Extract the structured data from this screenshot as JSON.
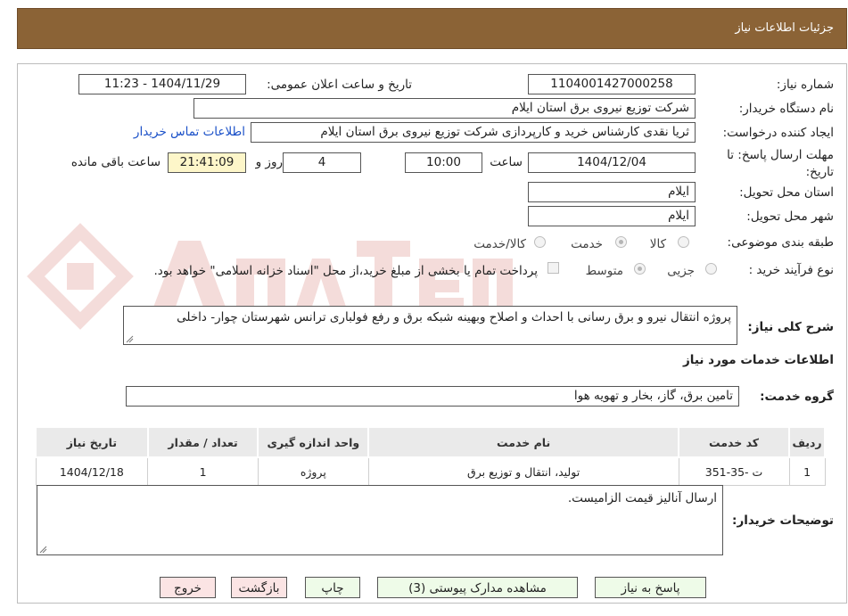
{
  "header": {
    "title": "جزئیات اطلاعات نیاز"
  },
  "form": {
    "need_number_label": "شماره نیاز:",
    "need_number": "1104001427000258",
    "announce_label": "تاریخ و ساعت اعلان عمومی:",
    "announce_value": "1404/11/29 - 11:23",
    "buyer_org_label": "نام دستگاه خریدار:",
    "buyer_org": "شرکت توزیع نیروی برق استان ایلام",
    "creator_label": "ایجاد کننده درخواست:",
    "creator": "ثریا نقدی کارشناس خرید و کارپردازی شرکت توزیع نیروی برق استان ایلام",
    "contact_link": "اطلاعات تماس خریدار",
    "deadline_label": "مهلت ارسال پاسخ: تا تاریخ:",
    "deadline_date": "1404/12/04",
    "time_label": "ساعت",
    "deadline_time": "10:00",
    "days_value": "4",
    "days_label": "روز و",
    "remaining_time": "21:41:09",
    "remaining_label": "ساعت باقی مانده",
    "province_label": "استان محل تحویل:",
    "province": "ایلام",
    "city_label": "شهر محل تحویل:",
    "city": "ایلام",
    "category_label": "طبقه بندی موضوعی:",
    "category_options": [
      "کالا",
      "خدمت",
      "کالا/خدمت"
    ],
    "category_selected": "خدمت",
    "process_label": "نوع فرآیند خرید :",
    "process_options": [
      "جزیی",
      "متوسط"
    ],
    "process_selected": "متوسط",
    "payment_note": "پرداخت تمام یا بخشی از مبلغ خرید،از محل \"اسناد خزانه اسلامی\" خواهد بود.",
    "description_label": "شرح کلی نیاز:",
    "description": "پروژه انتقال نیرو و برق رسانی با احداث و اصلاح وبهینه شبکه برق و رفع فولباری ترانس شهرستان چوار- داخلی"
  },
  "services": {
    "section_title": "اطلاعات خدمات مورد نیاز",
    "group_label": "گروه خدمت:",
    "group_value": "تامین برق، گاز، بخار و تهویه هوا",
    "columns": [
      "ردیف",
      "کد خدمت",
      "نام خدمت",
      "واحد اندازه گیری",
      "تعداد / مقدار",
      "تاریخ نیاز"
    ],
    "rows": [
      [
        "1",
        "ت -35-351",
        "تولید، انتقال و توزیع برق",
        "پروژه",
        "1",
        "1404/12/18"
      ]
    ]
  },
  "buyer_notes": {
    "label": "توضیحات خریدار:",
    "text": "ارسال آنالیز قیمت الزامیست."
  },
  "buttons": {
    "reply": "پاسخ به نیاز",
    "attachments": "مشاهده مدارک پیوستی (3)",
    "print": "چاپ",
    "back": "بازگشت",
    "exit": "خروج"
  },
  "colors": {
    "header_bg": "#8b6336",
    "button_green": "#eefbe8",
    "button_pink": "#fbe4e4",
    "remaining_bg": "#fdf6c9",
    "link": "#1a50c8"
  },
  "watermark_icons": [
    "anatender-logo-icon"
  ]
}
